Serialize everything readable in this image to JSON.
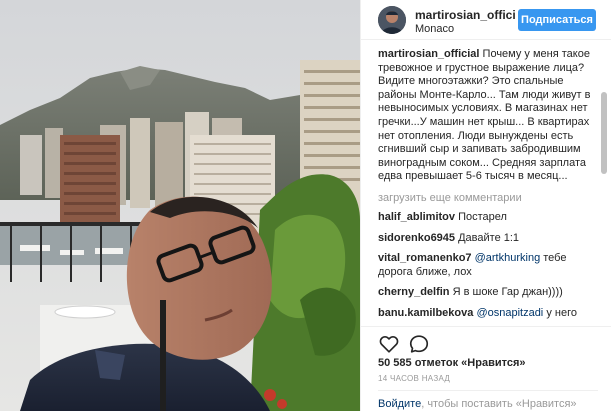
{
  "post": {
    "author": "martirosian_official",
    "location": "Monaco",
    "follow_label": "Подписаться"
  },
  "caption": {
    "author": "martirosian_official",
    "text": "Почему у меня такое тревожное и грустное выражение лица? Видите многоэтажки? Это спальные районы Монте-Карло... Там люди живут в невыносимых условиях. В магазинах нет гречки...У машин нет крыш... В квартирах нет отопления. Люди вынуждены есть сгнивший сыр и запивать забродившим виноградным соком... Средняя зарплата едва превышает 5-6 тысяч в месяц..."
  },
  "load_more": "загрузить еще комментарии",
  "comments": [
    {
      "user": "halif_ablimitov",
      "mention": "",
      "text": "Постарел"
    },
    {
      "user": "sidorenko6945",
      "mention": "",
      "text": "Давайте 1:1"
    },
    {
      "user": "vital_romanenko7",
      "mention": "@artkhurking",
      "text": "тебе дорога ближе, лох"
    },
    {
      "user": "cherny_delfin",
      "mention": "",
      "text": "Я в шоке Гар джан))))"
    },
    {
      "user": "banu.kamilbekova",
      "mention": "@osnapitzadi",
      "text": "у него"
    }
  ],
  "actions": {
    "likes_count": "50 585",
    "likes_suffix": "отметок «Нравится»",
    "timestamp": "14 ЧАСОВ НАЗАД",
    "login_link": "Войдите",
    "login_text": ", чтобы поставить «Нравится»"
  },
  "icons": {
    "like": "heart-icon",
    "comment": "speech-bubble-icon"
  },
  "colors": {
    "follow_button": "#3897f0",
    "link": "#003569",
    "muted": "#999999"
  }
}
